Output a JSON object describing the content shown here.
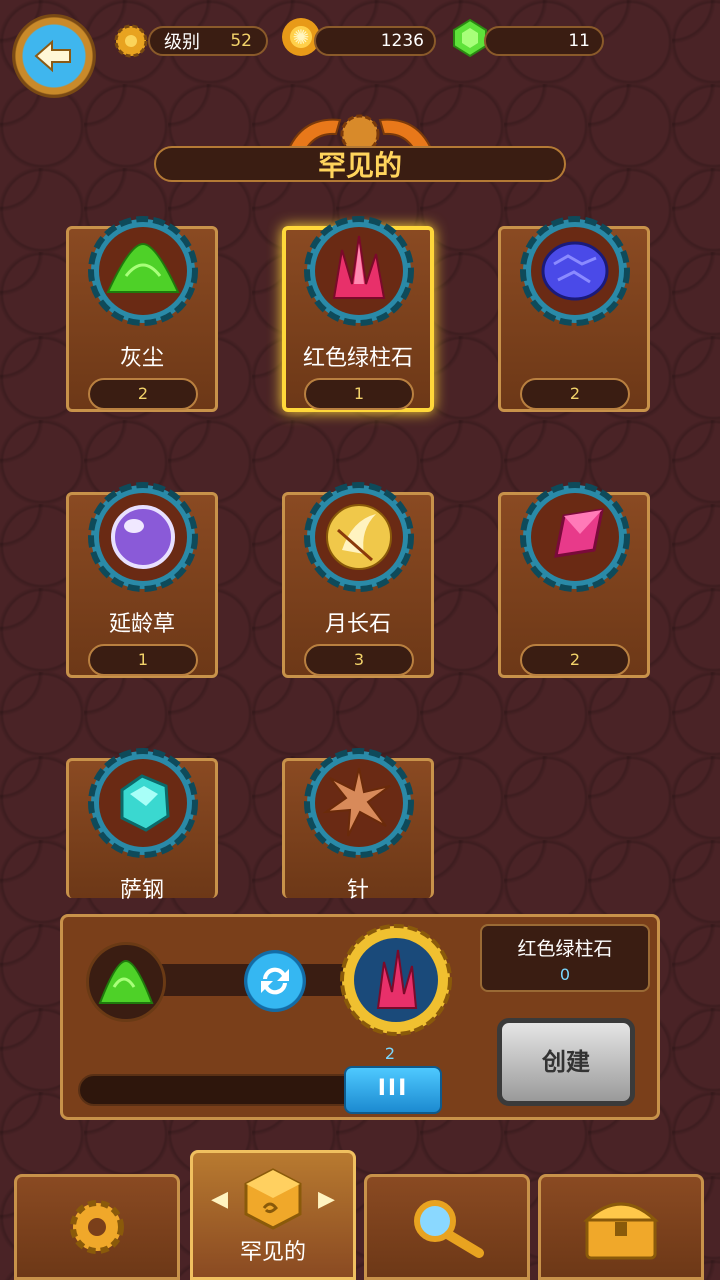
{
  "header": {
    "level_label": "级别",
    "level_value": "52",
    "coins": "1236",
    "gems": "11"
  },
  "title": "罕见的",
  "cards": [
    {
      "name": "灰尘",
      "count": "2",
      "icon": "green-dust-pile-icon"
    },
    {
      "name": "红色绿柱石",
      "count": "1",
      "icon": "red-crystal-icon",
      "selected": true
    },
    {
      "name": "",
      "count": "2",
      "icon": "blue-ore-icon"
    },
    {
      "name": "延龄草",
      "count": "1",
      "icon": "purple-orb-icon"
    },
    {
      "name": "月长石",
      "count": "3",
      "icon": "moonstone-icon"
    },
    {
      "name": "",
      "count": "2",
      "icon": "pink-gem-icon"
    },
    {
      "name": "萨钢",
      "count": "",
      "icon": "teal-crystal-icon"
    },
    {
      "name": "针",
      "count": "",
      "icon": "spiky-thorn-icon"
    }
  ],
  "craft": {
    "result_name": "红色绿柱石",
    "result_count": "0",
    "amount": "2",
    "slider_label": "III",
    "create_label": "创建"
  },
  "tabs": [
    {
      "label": "",
      "icon": "gear-icon"
    },
    {
      "label": "罕见的",
      "icon": "cube-icon"
    },
    {
      "label": "",
      "icon": "magnifier-icon"
    },
    {
      "label": "",
      "icon": "chest-icon"
    }
  ],
  "colors": {
    "accent": "#ffd45c",
    "background": "#4a2326",
    "card": "#7a3f1a",
    "highlight": "#ffd83a"
  }
}
